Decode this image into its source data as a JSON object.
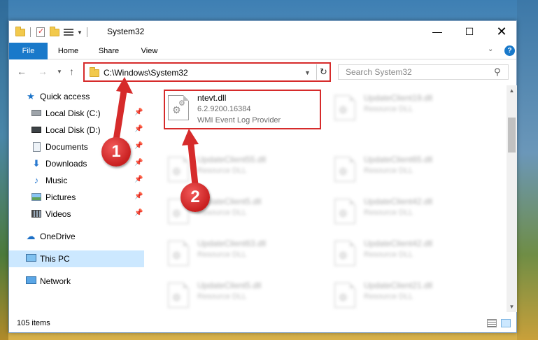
{
  "window": {
    "title": "System32",
    "controls": {
      "minimize": "—",
      "maximize": "☐",
      "close": "✕"
    }
  },
  "ribbon": {
    "tabs": [
      {
        "label": "File",
        "active": true
      },
      {
        "label": "Home"
      },
      {
        "label": "Share"
      },
      {
        "label": "View"
      }
    ],
    "help": "?"
  },
  "address": {
    "path": "C:\\Windows\\System32",
    "refresh": "↻"
  },
  "search": {
    "placeholder": "Search System32"
  },
  "sidebar": {
    "items": [
      {
        "label": "Quick access",
        "icon": "star-icon"
      },
      {
        "label": "Local Disk (C:)",
        "icon": "drive-icon",
        "pinned": true
      },
      {
        "label": "Local Disk (D:)",
        "icon": "drive-icon",
        "pinned": true
      },
      {
        "label": "Documents",
        "icon": "documents-icon",
        "pinned": true
      },
      {
        "label": "Downloads",
        "icon": "downloads-icon",
        "pinned": true
      },
      {
        "label": "Music",
        "icon": "music-icon",
        "pinned": true
      },
      {
        "label": "Pictures",
        "icon": "pictures-icon",
        "pinned": true
      },
      {
        "label": "Videos",
        "icon": "videos-icon",
        "pinned": true
      },
      {
        "label": "OneDrive",
        "icon": "cloud-icon"
      },
      {
        "label": "This PC",
        "icon": "computer-icon",
        "selected": true
      },
      {
        "label": "Network",
        "icon": "network-icon"
      }
    ]
  },
  "files": {
    "selected": {
      "name": "ntevt.dll",
      "version": "6.2.9200.16384",
      "description": "WMI Event Log Provider"
    },
    "blurred": [
      {
        "name": "UpdateClient19.dll",
        "type": "Resource DLL"
      },
      {
        "name": "UpdateClient55.dll",
        "type": "Resource DLL"
      },
      {
        "name": "UpdateClient65.dll",
        "type": "Resource DLL"
      },
      {
        "name": "UpdateClient5.dll",
        "type": "Resource DLL"
      },
      {
        "name": "UpdateClient42.dll",
        "type": "Resource DLL"
      },
      {
        "name": "UpdateClient63.dll",
        "type": "Resource DLL"
      },
      {
        "name": "UpdateClient42.dll",
        "type": "Resource DLL"
      },
      {
        "name": "UpdateClient5.dll",
        "type": "Resource DLL"
      },
      {
        "name": "UpdateClient21.dll",
        "type": "Resource DLL"
      }
    ]
  },
  "status": {
    "item_count": "105 items"
  },
  "annotations": {
    "step1": "1",
    "step2": "2",
    "color": "#d62b2b"
  }
}
